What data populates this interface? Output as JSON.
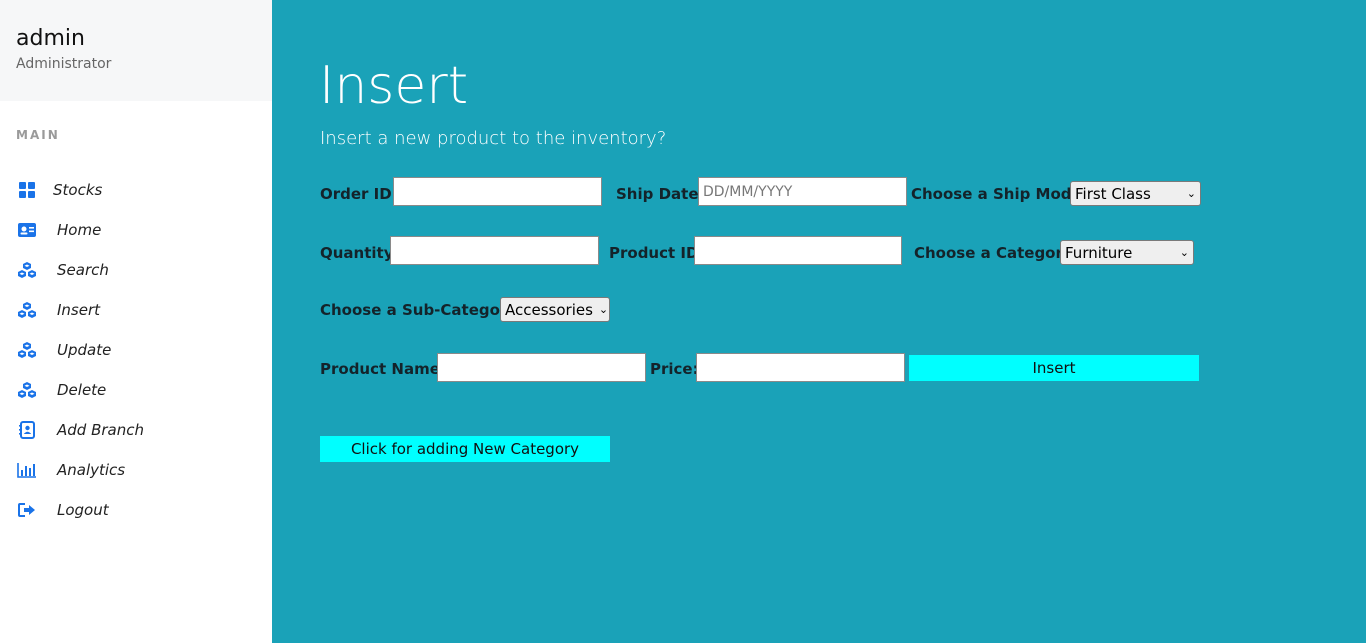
{
  "user": {
    "name": "admin",
    "role": "Administrator"
  },
  "sidebar": {
    "section": "MAIN",
    "items": [
      {
        "label": "Stocks",
        "icon": "grid-icon"
      },
      {
        "label": "Home",
        "icon": "id-card-icon"
      },
      {
        "label": "Search",
        "icon": "boxes-icon"
      },
      {
        "label": "Insert",
        "icon": "boxes-icon"
      },
      {
        "label": "Update",
        "icon": "boxes-icon"
      },
      {
        "label": "Delete",
        "icon": "boxes-icon"
      },
      {
        "label": "Add Branch",
        "icon": "contact-book-icon"
      },
      {
        "label": "Analytics",
        "icon": "bar-chart-icon"
      },
      {
        "label": "Logout",
        "icon": "sign-out-icon"
      }
    ]
  },
  "page": {
    "title": "Insert",
    "subtitle": "Insert a new product to the inventory?"
  },
  "form": {
    "order_id_label": "Order ID:",
    "order_id_value": "",
    "ship_date_label": "Ship Date:",
    "ship_date_placeholder": "DD/MM/YYYY",
    "ship_mode_label": "Choose a Ship Mode:",
    "ship_mode_value": "First Class",
    "quantity_label": "Quantity:",
    "quantity_value": "",
    "product_id_label": "Product ID:",
    "product_id_value": "",
    "category_label": "Choose a Category:",
    "category_value": "Furniture",
    "sub_category_label": "Choose a Sub-Category:",
    "sub_category_value": "Accessories",
    "product_name_label": "Product Name:",
    "product_name_value": "",
    "price_label": "Price:",
    "price_value": "",
    "insert_button": "Insert",
    "new_category_button": "Click for adding New Category"
  },
  "colors": {
    "main_bg": "#1aa2b8",
    "button_bg": "#00ffff",
    "icon_blue": "#1a73e8"
  }
}
